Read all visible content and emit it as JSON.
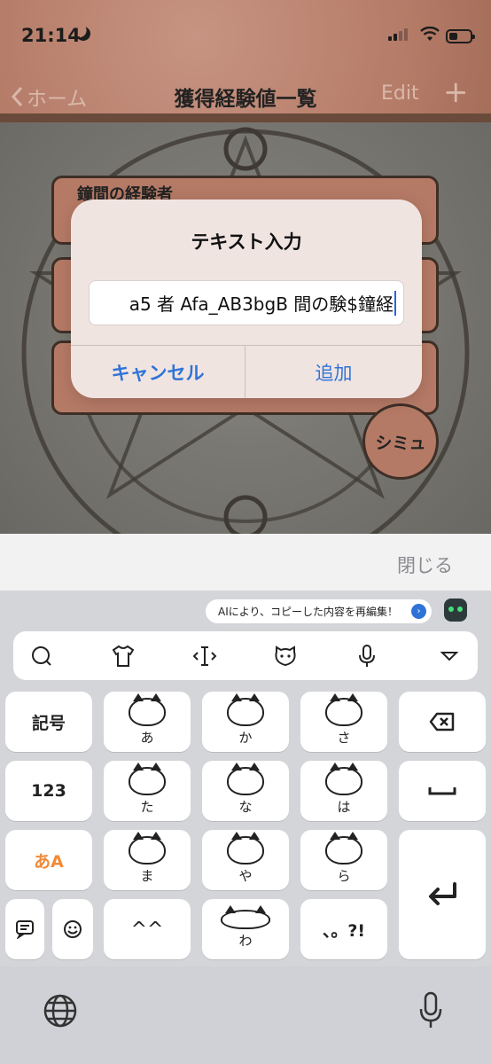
{
  "status": {
    "time": "21:14"
  },
  "nav": {
    "back": "ホーム",
    "title": "獲得経験値一覧",
    "edit": "Edit",
    "plus": "+"
  },
  "cards": [
    {
      "title": "鐘間の経験者"
    }
  ],
  "fab": {
    "label": "シミュ"
  },
  "alert": {
    "title": "テキスト入力",
    "input_value": "a5 者 Afa_AB3bgB 間の験$鐘経",
    "cancel": "キャンセル",
    "add": "追加"
  },
  "accessory": {
    "close": "閉じる"
  },
  "keyboard": {
    "ai_chip": "AIにより、コピーした内容を再編集！",
    "keys": {
      "symbols": "記号",
      "numbers": "123",
      "kana_mode": "あA",
      "a": "あ",
      "ka": "か",
      "sa": "さ",
      "ta": "た",
      "na": "な",
      "ha": "は",
      "ma": "ま",
      "ya": "や",
      "ra": "ら",
      "wa": "わ",
      "face": "^^",
      "punct": "、。?!"
    }
  }
}
